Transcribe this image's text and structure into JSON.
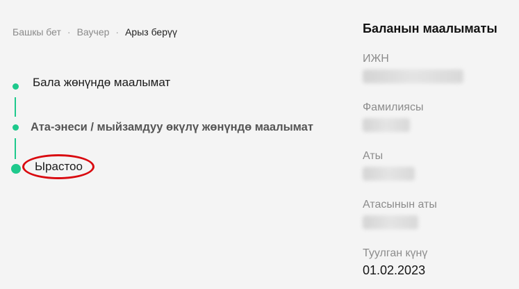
{
  "breadcrumb": {
    "items": [
      "Башкы бет",
      "Ваучер",
      "Арыз берүү"
    ],
    "separator": "·"
  },
  "steps": [
    {
      "label": "Бала жөнүндө маалымат"
    },
    {
      "label": "Ата-энеси / мыйзамдуу өкүлү жөнүндө маалымат"
    },
    {
      "label": "Ырастоо",
      "current": true,
      "highlighted": true
    }
  ],
  "colors": {
    "accent": "#1ec98c",
    "highlight": "#d9090f",
    "background": "#f4f4f4"
  },
  "panel": {
    "title": "Баланын маалыматы",
    "fields": [
      {
        "label": "ИЖН",
        "value_hidden": true
      },
      {
        "label": "Фамилиясы",
        "value_hidden": true
      },
      {
        "label": "Аты",
        "value_hidden": true
      },
      {
        "label": "Атасынын аты",
        "value_hidden": true
      },
      {
        "label": "Туулган күнү",
        "value": "01.02.2023"
      }
    ]
  }
}
